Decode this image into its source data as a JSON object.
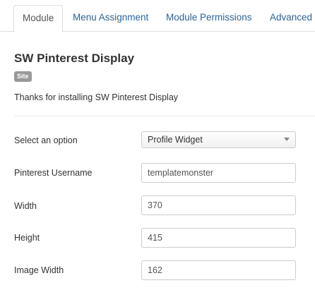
{
  "tabs": [
    {
      "label": "Module",
      "active": true
    },
    {
      "label": "Menu Assignment",
      "active": false
    },
    {
      "label": "Module Permissions",
      "active": false
    },
    {
      "label": "Advanced",
      "active": false
    }
  ],
  "module": {
    "title": "SW Pinterest Display",
    "badge": "Site",
    "description": "Thanks for installing SW Pinterest Display"
  },
  "fields": {
    "option": {
      "label": "Select an option",
      "value": "Profile Widget"
    },
    "username": {
      "label": "Pinterest Username",
      "value": "templatemonster"
    },
    "width": {
      "label": "Width",
      "value": "370"
    },
    "height": {
      "label": "Height",
      "value": "415"
    },
    "image_width": {
      "label": "Image Width",
      "value": "162"
    }
  },
  "colors": {
    "link": "#2a6496",
    "badge": "#999999",
    "border": "#cccccc"
  }
}
